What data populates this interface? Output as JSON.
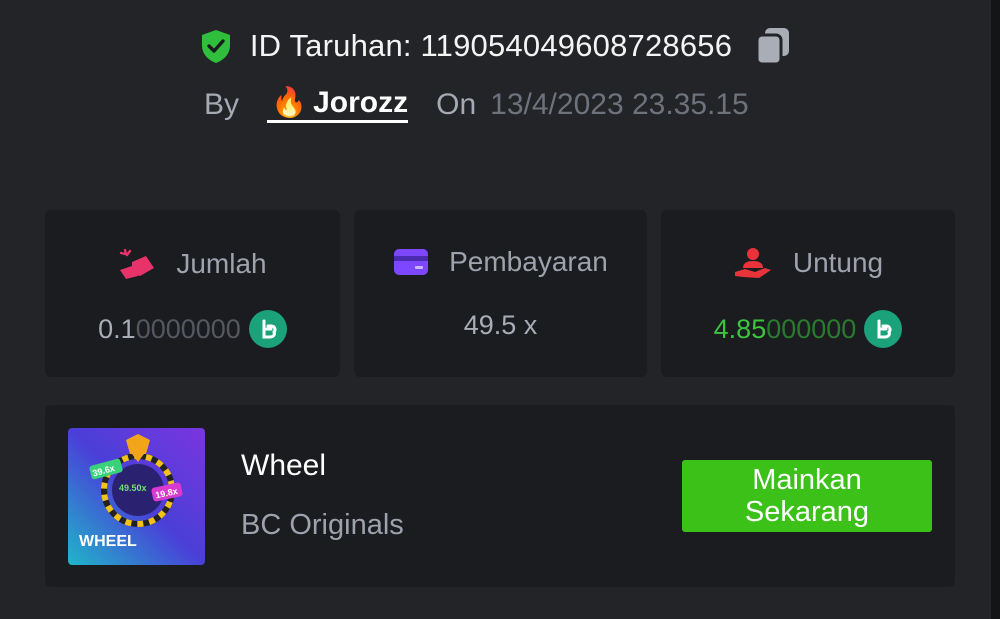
{
  "header": {
    "bet_id_label": "ID Taruhan: 119054049608728656",
    "by_label": "By",
    "username": "Jorozz",
    "on_label": "On",
    "date": "13/4/2023 23.35.15"
  },
  "stats": [
    {
      "label": "Jumlah",
      "icon": "amount-icon",
      "value_main": "0.1",
      "value_dim": "0000000",
      "coin_icon": "bc-coin-icon"
    },
    {
      "label": "Pembayaran",
      "icon": "card-icon",
      "value": "49.5 x"
    },
    {
      "label": "Untung",
      "icon": "profit-hand-icon",
      "value_main": "4.85",
      "value_dim": "000000",
      "coin_icon": "bc-coin-icon"
    }
  ],
  "game": {
    "title": "Wheel",
    "provider": "BC Originals",
    "play_line1": "Mainkan",
    "play_line2": "Sekarang",
    "thumb_title": "WHEEL",
    "thumb_labels": [
      "39.6x",
      "49.50x",
      "19.8x"
    ]
  },
  "colors": {
    "background": "#232428",
    "card": "#1b1c20",
    "accent_green": "#3bc117",
    "profit_green": "#3dc43d",
    "coin": "#1ba27a"
  }
}
